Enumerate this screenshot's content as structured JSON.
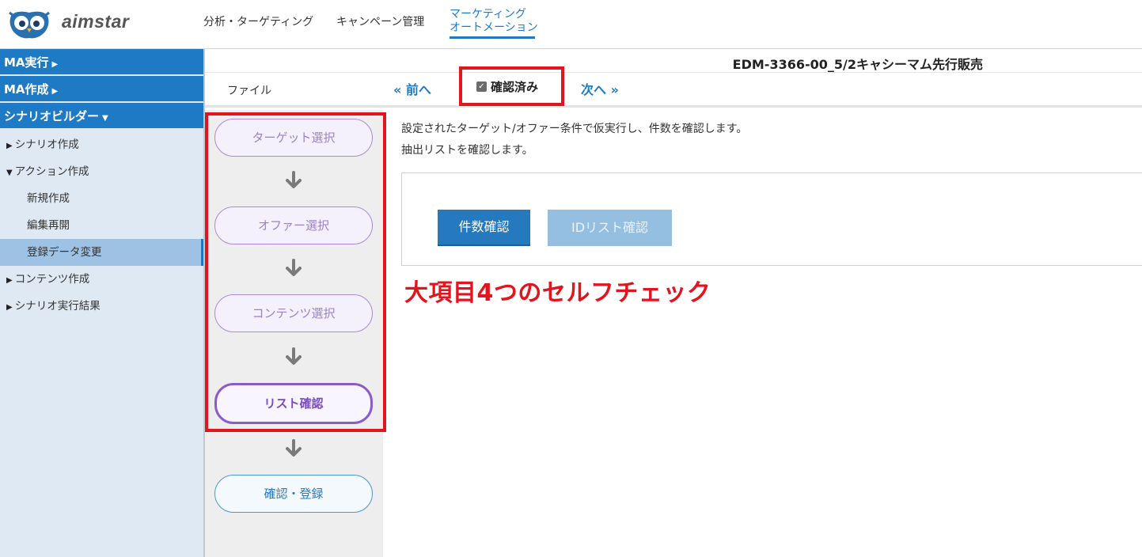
{
  "header": {
    "logo_text": "aimstar",
    "nav": {
      "analysis": "分析・ターゲティング",
      "campaign": "キャンペーン管理",
      "ma_line1": "マーケティング",
      "ma_line2": "オートメーション"
    }
  },
  "sidebar": {
    "ma_run": "MA実行",
    "ma_create": "MA作成",
    "scenario_builder": "シナリオビルダー",
    "scenario_create": "シナリオ作成",
    "action_create": "アクション作成",
    "new_create": "新規作成",
    "edit_resume": "編集再開",
    "data_change": "登録データ変更",
    "content_create": "コンテンツ作成",
    "scenario_result": "シナリオ実行結果"
  },
  "page": {
    "title": "EDM-3366-00_5/2キャシーマム先行販売"
  },
  "toolbar": {
    "file": "ファイル",
    "prev": "« 前へ",
    "confirmed": "確認済み",
    "next": "次へ »"
  },
  "steps": {
    "target": "ターゲット選択",
    "offer": "オファー選択",
    "content": "コンテンツ選択",
    "list": "リスト確認",
    "register": "確認・登録"
  },
  "main": {
    "desc_line1": "設定されたターゲット/オファー条件で仮実行し、件数を確認します。",
    "desc_line2": "抽出リストを確認します。",
    "count_button": "件数確認",
    "idlist_button": "IDリスト確認",
    "annotation": "大項目4つのセルフチェック"
  },
  "colors": {
    "accent_blue": "#1f7ac5",
    "highlight_red": "#e0151d",
    "step_purple": "#8b5cc9"
  }
}
